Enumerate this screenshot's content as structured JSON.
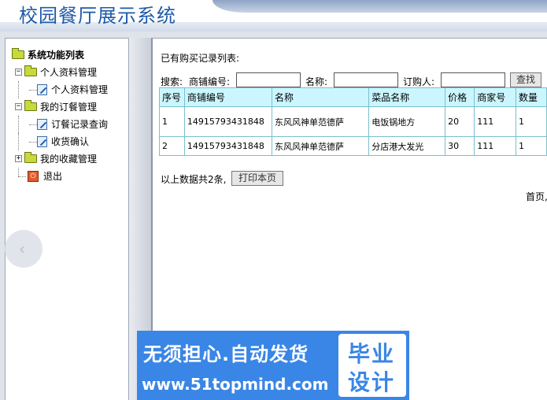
{
  "header": {
    "title": "校园餐厅展示系统"
  },
  "sidebar": {
    "root": "系统功能列表",
    "groups": [
      {
        "label": "个人资料管理",
        "children": [
          "个人资料管理"
        ]
      },
      {
        "label": "我的订餐管理",
        "children": [
          "订餐记录查询",
          "收货确认"
        ]
      },
      {
        "label": "我的收藏管理",
        "children": []
      }
    ],
    "exit": "退出"
  },
  "main": {
    "list_title": "已有购买记录列表:",
    "search": {
      "prefix": "搜索:",
      "store_no_label": "商铺编号:",
      "name_label": "名称:",
      "buyer_label": "订购人:",
      "store_no_value": "",
      "name_value": "",
      "buyer_value": "",
      "button": "查找"
    },
    "table": {
      "columns": [
        "序号",
        "商铺编号",
        "名称",
        "菜品名称",
        "价格",
        "商家号",
        "数量"
      ],
      "rows": [
        [
          "1",
          "14915793431848",
          "东风风神单范德萨",
          "电饭锅地方",
          "20",
          "111",
          "1"
        ],
        [
          "2",
          "14915793431848",
          "东风风神单范德萨",
          "分店港大发光",
          "30",
          "111",
          "1"
        ]
      ]
    },
    "total": "以上数据共2条,",
    "print_button": "打印本页",
    "pager": "首页,"
  },
  "watermark": {
    "line1": "无须担心.自动发货",
    "line2": "www.51topmind.com",
    "badge_line1": "毕业",
    "badge_line2": "设计"
  }
}
